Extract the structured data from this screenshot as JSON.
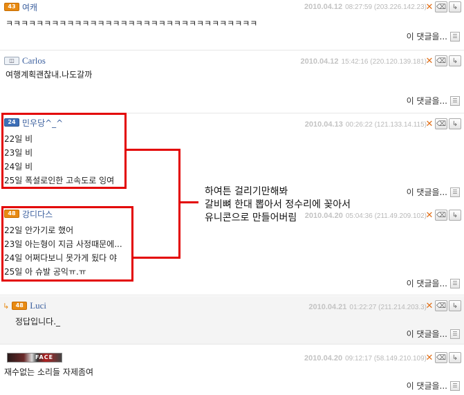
{
  "comments": [
    {
      "level": "43",
      "nick": "여캐",
      "date": "2010.04.12",
      "time": "08:27:59",
      "ip": "(203.226.142.23)",
      "lines": [
        "ㅋㅋㅋㅋㅋㅋㅋㅋㅋㅋㅋㅋㅋㅋㅋㅋㅋㅋㅋㅋㅋㅋㅋㅋㅋㅋㅋㅋㅋㅋㅋㅋㅋ"
      ],
      "more": "이 댓글을..."
    },
    {
      "level": "",
      "nick": "Carlos",
      "date": "2010.04.12",
      "time": "15:42:16",
      "ip": "(220.120.139.181)",
      "lines": [
        "여행계획괜찮내.나도갈까"
      ],
      "more": "이 댓글을..."
    },
    {
      "level": "24",
      "nick": "민우당^_^",
      "date": "2010.04.13",
      "time": "00:26:22",
      "ip": "(121.133.14.115)",
      "lines": [
        "22일 비",
        "23일 비",
        "24일 비",
        "25일 폭설로인한 고속도로 잉여"
      ],
      "more": "이 댓글을..."
    },
    {
      "level": "48",
      "nick": "강디다스",
      "date": "2010.04.20",
      "time": "05:04:36",
      "ip": "(211.49.209.102)",
      "lines": [
        "22일 안가기로 했어",
        "23일 아는형이 지금 사정때문에...",
        "24일 어쩌다보니 못가게 됬다 야",
        "25일 아 슈발 공익ㅠ.ㅠ"
      ],
      "more": "이 댓글을..."
    },
    {
      "level": "48",
      "nick": "Luci",
      "date": "2010.04.21",
      "time": "01:22:27",
      "ip": "(211.214.203.3)",
      "lines": [
        "정답입니다._"
      ],
      "more": "이 댓글을..."
    },
    {
      "level": "",
      "nick": "",
      "date": "2010.04.20",
      "time": "09:12:17",
      "ip": "(58.149.210.109)",
      "lines": [
        "재수없는 소리들 자제좀여"
      ],
      "more": "이 댓글을...",
      "avatar_text": "FACE"
    }
  ],
  "annotation": [
    "하여튼 걸리기만해봐",
    "갈비뼈 한대 뽑아서 정수리에 꽂아서",
    "유니콘으로 만들어버림"
  ],
  "icons": {
    "delete": "x-icon",
    "edit": "eraser-icon",
    "reply": "reply-arrow-icon"
  },
  "colors": {
    "highlight": "#e30000",
    "level_badge": "#e88a12",
    "nick": "#3b5f9e"
  }
}
